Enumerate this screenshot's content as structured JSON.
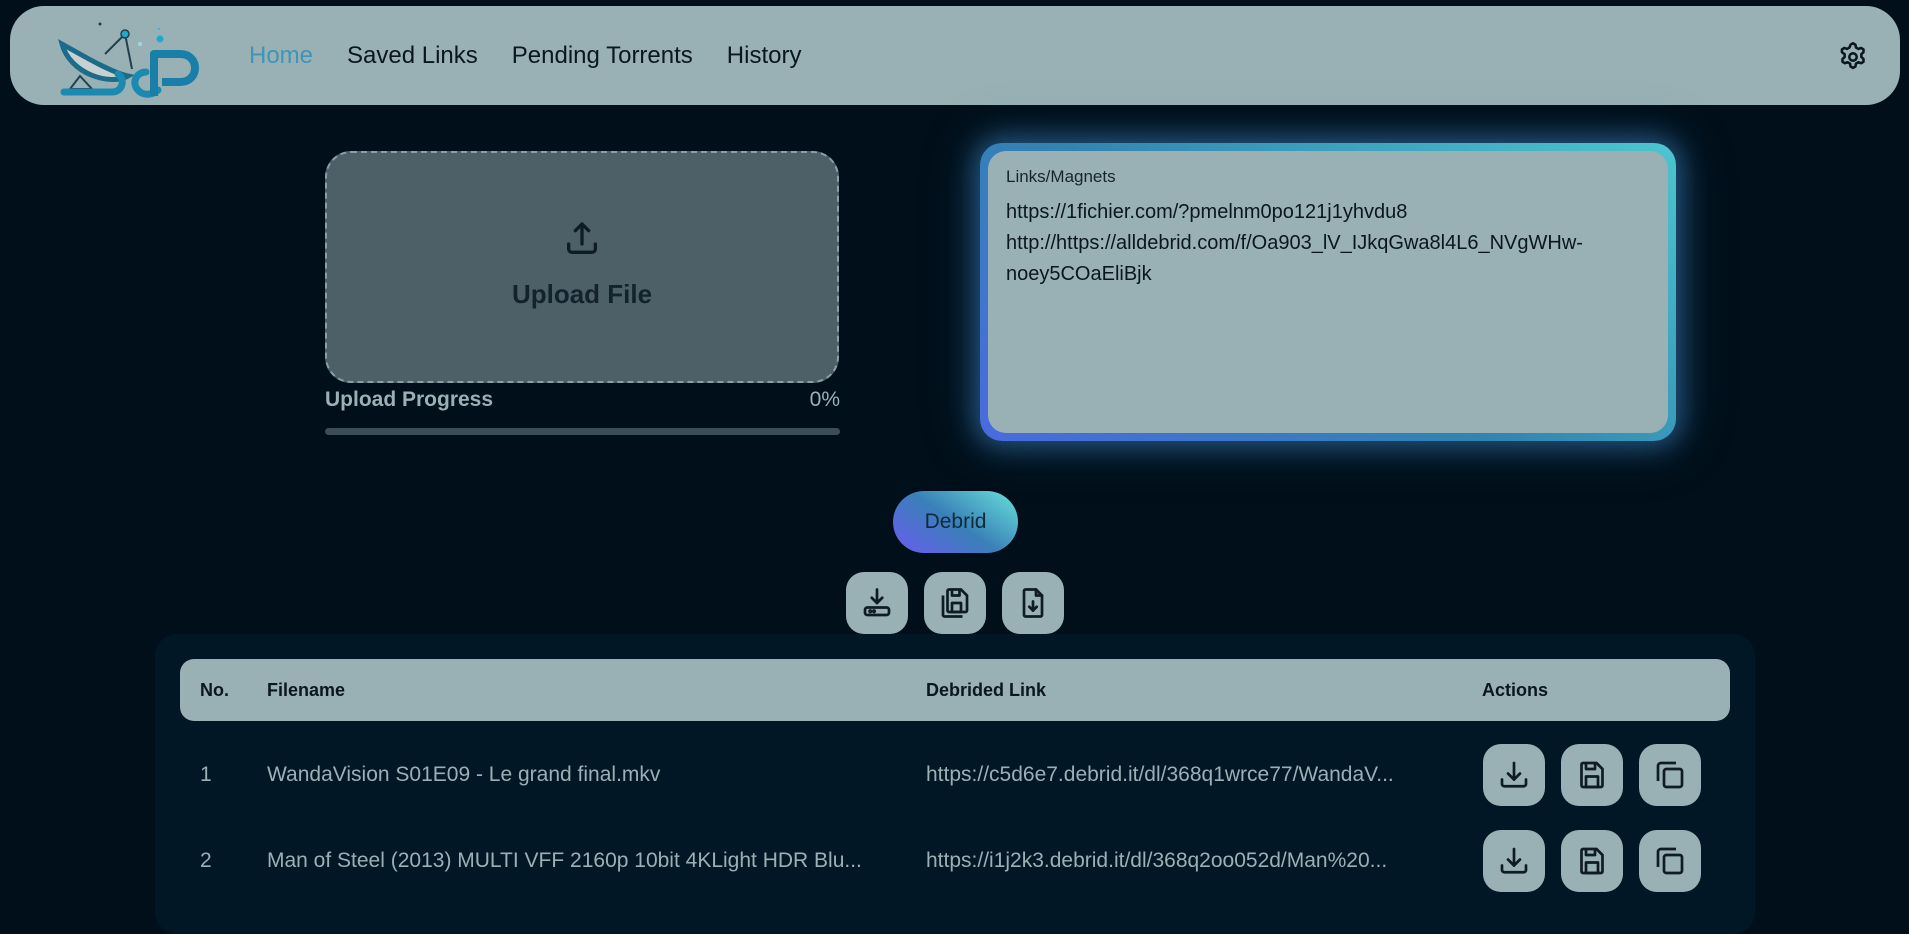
{
  "navbar": {
    "logo_alt": "DCP",
    "links": [
      {
        "label": "Home",
        "active": true
      },
      {
        "label": "Saved Links",
        "active": false
      },
      {
        "label": "Pending Torrents",
        "active": false
      },
      {
        "label": "History",
        "active": false
      }
    ],
    "settings_icon": "gear-icon"
  },
  "upload": {
    "label": "Upload File",
    "icon": "upload-icon",
    "progress_label": "Upload Progress",
    "progress_value": "0%",
    "progress_fraction": 0
  },
  "links_input": {
    "label": "Links/Magnets",
    "value": "https://1fichier.com/?pmelnm0po121j1yhvdu8\nhttp://https://alldebrid.com/f/Oa903_lV_IJkqGwa8l4L6_NVgWHw-noey5COaEliBjk"
  },
  "debrid_button": {
    "label": "Debrid"
  },
  "bulk_actions": [
    {
      "name": "download-all",
      "icon": "download-to-device-icon"
    },
    {
      "name": "save-all",
      "icon": "save-multiple-icon"
    },
    {
      "name": "export-file",
      "icon": "file-download-icon"
    }
  ],
  "table": {
    "headers": [
      "No.",
      "Filename",
      "Debrided Link",
      "Actions"
    ],
    "rows": [
      {
        "no": "1",
        "filename": "WandaVision S01E09 - Le grand final.mkv",
        "link": "https://c5d6e7.debrid.it/dl/368q1wrce77/WandaV..."
      },
      {
        "no": "2",
        "filename": "Man of Steel (2013) MULTI VFF 2160p 10bit 4KLight HDR Blu...",
        "link": "https://i1j2k3.debrid.it/dl/368q2oo052d/Man%20..."
      }
    ],
    "row_actions": [
      "download-icon",
      "save-icon",
      "copy-icon"
    ]
  },
  "colors": {
    "background": "#000f19",
    "panel": "#99b1b5",
    "accent_active": "#3f94b8",
    "table_bg": "#011726"
  }
}
